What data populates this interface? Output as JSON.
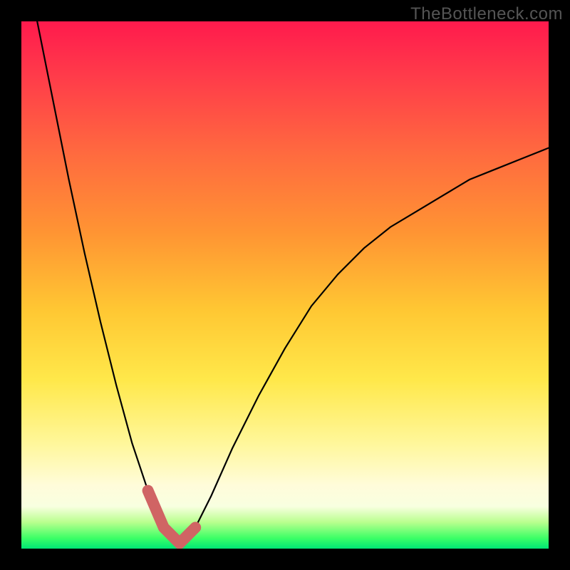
{
  "watermark": "TheBottleneck.com",
  "chart_data": {
    "type": "line",
    "title": "",
    "xlabel": "",
    "ylabel": "",
    "xlim": [
      0,
      100
    ],
    "ylim": [
      0,
      100
    ],
    "grid": false,
    "legend": false,
    "highlight": {
      "color": "#d06464",
      "x_range": [
        23,
        33
      ],
      "description": "salmon V-shaped marker near curve minimum"
    },
    "gradient_stops": [
      {
        "pos": 0,
        "color": "#ff1a4d"
      },
      {
        "pos": 25,
        "color": "#ff6a3f"
      },
      {
        "pos": 55,
        "color": "#ffc833"
      },
      {
        "pos": 80,
        "color": "#fff79a"
      },
      {
        "pos": 95,
        "color": "#b9ff8e"
      },
      {
        "pos": 100,
        "color": "#00e676"
      }
    ],
    "series": [
      {
        "name": "bottleneck-curve",
        "color": "#000000",
        "x": [
          3,
          6,
          9,
          12,
          15,
          18,
          21,
          24,
          27,
          30,
          33,
          36,
          40,
          45,
          50,
          55,
          60,
          65,
          70,
          75,
          80,
          85,
          90,
          95,
          100
        ],
        "y": [
          100,
          85,
          70,
          56,
          43,
          31,
          20,
          11,
          4,
          1,
          4,
          10,
          19,
          29,
          38,
          46,
          52,
          57,
          61,
          64,
          67,
          70,
          72,
          74,
          76
        ]
      }
    ]
  }
}
